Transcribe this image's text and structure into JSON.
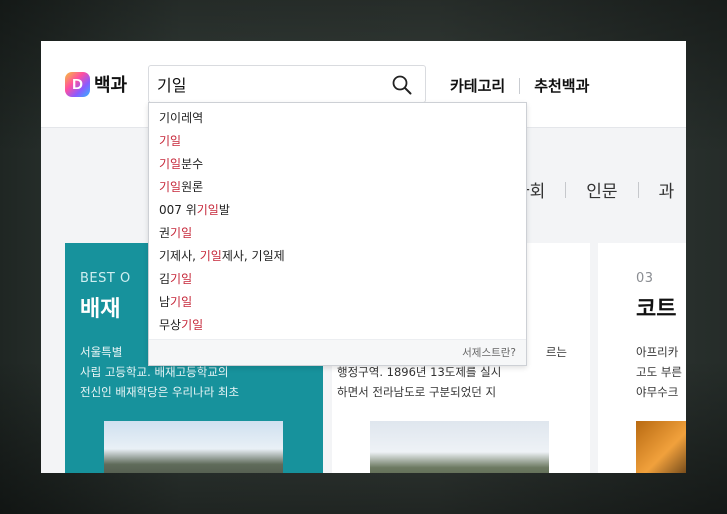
{
  "header": {
    "logo_letter": "D",
    "logo_text": "백과",
    "search_value": "기일",
    "nav": [
      {
        "label": "카테고리"
      },
      {
        "label": "추천백과"
      }
    ]
  },
  "subnav": {
    "items": [
      {
        "label": "사회"
      },
      {
        "label": "인문"
      },
      {
        "label": "과"
      }
    ]
  },
  "suggestions": [
    {
      "pre": "기이레역",
      "hl": "",
      "post": ""
    },
    {
      "pre": "",
      "hl": "기일",
      "post": ""
    },
    {
      "pre": "",
      "hl": "기일",
      "post": "분수"
    },
    {
      "pre": "",
      "hl": "기일",
      "post": "원론"
    },
    {
      "pre": "007 위",
      "hl": "기일",
      "post": "발"
    },
    {
      "pre": "권",
      "hl": "기일",
      "post": ""
    },
    {
      "pre": "기제사, ",
      "hl": "기일",
      "post": "제사, 기일제"
    },
    {
      "pre": "김",
      "hl": "기일",
      "post": ""
    },
    {
      "pre": "남",
      "hl": "기일",
      "post": ""
    },
    {
      "pre": "무상",
      "hl": "기일",
      "post": ""
    }
  ],
  "dropdown_footer": "서제스트란?",
  "cards": [
    {
      "kicker": "BEST O",
      "title": "배재",
      "desc": [
        "서울특별",
        "사립 고등학교. 배재고등학교의",
        "전신인 배재학당은 우리나라 최초"
      ]
    },
    {
      "kicker": "",
      "title": "",
      "desc": [
        "르는",
        "행정구역. 1896년 13도제를 실시",
        "하면서 전라남도로 구분되었던 지"
      ]
    },
    {
      "kicker": "03",
      "title": "코트",
      "desc": [
        "아프리카",
        "고도 부른",
        "야무수크"
      ]
    }
  ],
  "colors": {
    "highlight": "#c6283a",
    "teal_card": "#17929c"
  }
}
